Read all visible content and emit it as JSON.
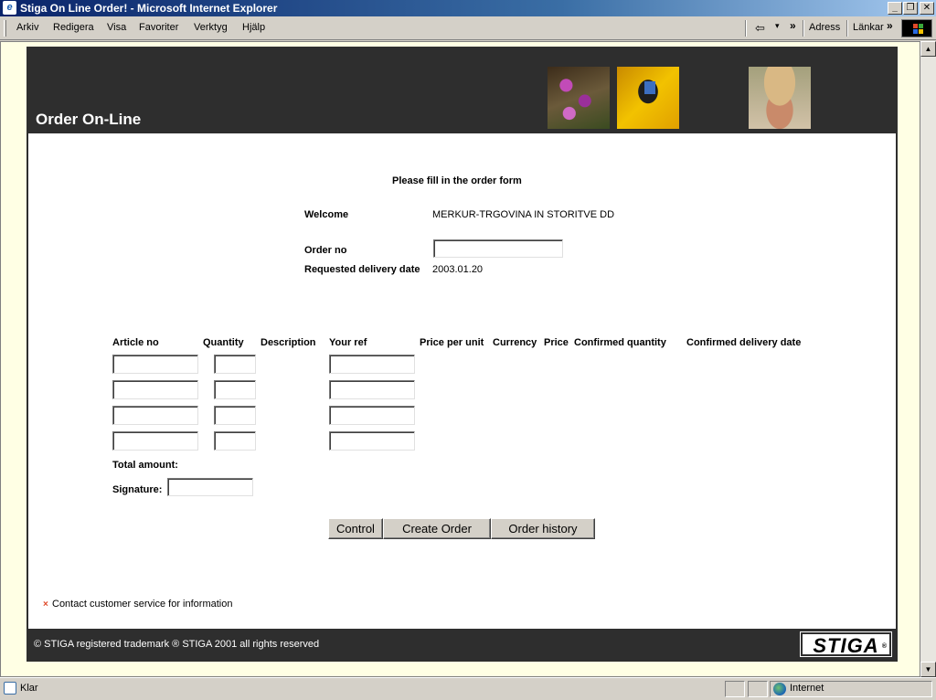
{
  "window": {
    "title": "Stiga On Line Order! - Microsoft Internet Explorer",
    "buttons": [
      "_",
      "❐",
      "✕"
    ]
  },
  "menu": {
    "items": [
      "Arkiv",
      "Redigera",
      "Visa",
      "Favoriter",
      "Verktyg",
      "Hjälp"
    ],
    "back_glyph": "⇦",
    "dropdown_glyph": "▾",
    "chevron": "»",
    "address_label": "Adress",
    "links_label": "Länkar"
  },
  "page": {
    "stray_char": "e",
    "header_title": "Order On-Line",
    "instruction": "Please fill in the order form",
    "welcome_label": "Welcome",
    "welcome_value": "MERKUR-TRGOVINA IN STORITVE DD",
    "order_no_label": "Order no",
    "order_no_value": "",
    "delivery_label": "Requested delivery date",
    "delivery_value": "2003.01.20",
    "columns": [
      "Article no",
      "Quantity",
      "Description",
      "Your ref",
      "Price per unit",
      "Currency",
      "Price",
      "Confirmed quantity",
      "Confirmed delivery date"
    ],
    "rows": [
      {
        "article": "",
        "quantity": "",
        "ref": ""
      },
      {
        "article": "",
        "quantity": "",
        "ref": ""
      },
      {
        "article": "",
        "quantity": "",
        "ref": ""
      },
      {
        "article": "",
        "quantity": "",
        "ref": ""
      }
    ],
    "total_label": "Total amount:",
    "signature_label": "Signature:",
    "signature_value": "",
    "buttons": {
      "control": "Control",
      "create": "Create Order",
      "history": "Order history"
    },
    "contact_mark": "×",
    "contact_text": "Contact customer service for information",
    "footer": "© STIGA registered trademark  ®  STIGA 2001 all rights reserved",
    "logo_text": "STIGA",
    "logo_reg": "®"
  },
  "status": {
    "text": "Klar",
    "zone": "Internet"
  },
  "colors": {
    "header_bg": "#2e2e2e",
    "title_bar": "#0a246a",
    "contact_mark": "#e04a2a"
  }
}
